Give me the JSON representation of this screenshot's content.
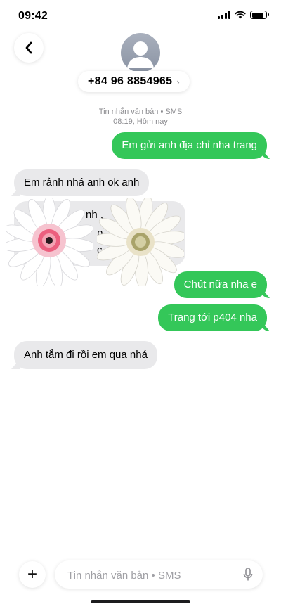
{
  "status": {
    "time": "09:42",
    "icons": [
      "signal-icon",
      "wifi-icon",
      "battery-icon"
    ]
  },
  "header": {
    "contact": "+84 96 8854965",
    "back_icon": "chevron-left-icon",
    "avatar_icon": "person-silhouette-icon"
  },
  "meta": {
    "service": "Tin nhắn văn bản • SMS",
    "timestamp": "08:19, Hôm nay"
  },
  "messages": [
    {
      "direction": "outgoing",
      "text": "Em gửi anh địa chỉ nha trang"
    },
    {
      "direction": "incoming",
      "text": "Em rảnh nhá anh ok anh"
    },
    {
      "direction": "incoming",
      "partial_visible": [
        "nh ,",
        "p",
        "c"
      ]
    },
    {
      "direction": "outgoing",
      "text": "Chút nữa nha e"
    },
    {
      "direction": "outgoing",
      "text": "Trang tới p404 nha"
    },
    {
      "direction": "incoming",
      "text": "Anh tắm đi rồi em qua nhá"
    }
  ],
  "stickers": [
    "pink-gerbera-flower",
    "white-gerbera-flower"
  ],
  "composer": {
    "placeholder": "Tin nhắn văn bản • SMS",
    "plus_label": "+",
    "mic_icon": "microphone-icon"
  },
  "colors": {
    "outgoing_bubble": "#34c759",
    "incoming_bubble": "#e9e9eb",
    "meta_text": "#8a8a8e"
  }
}
